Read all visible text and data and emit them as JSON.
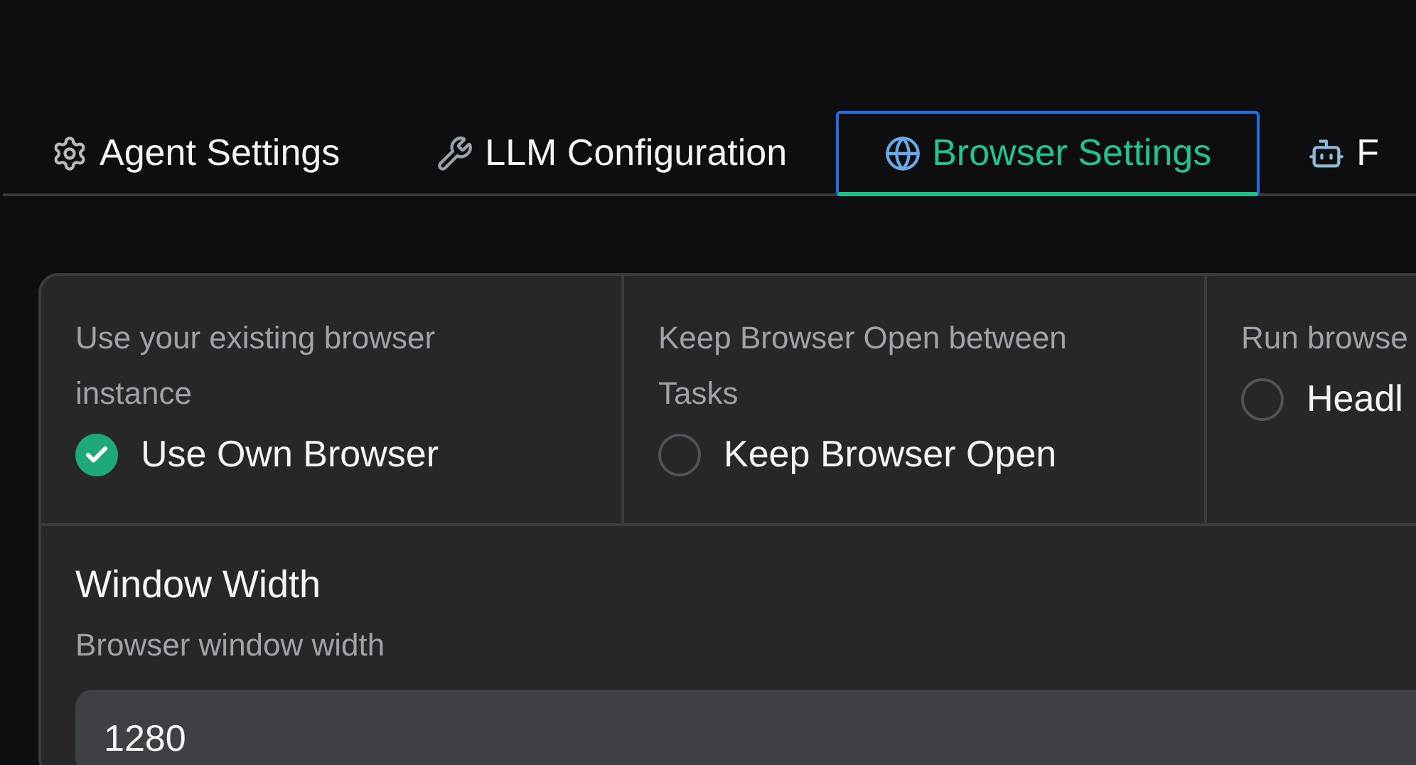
{
  "tabs": [
    {
      "label": "Agent Settings",
      "selected": false
    },
    {
      "label": "LLM Configuration",
      "selected": false
    },
    {
      "label": "Browser Settings",
      "selected": true
    },
    {
      "label": "F",
      "selected": false
    }
  ],
  "options": [
    {
      "description": "Use your existing browser instance",
      "label": "Use Own Browser",
      "checked": true
    },
    {
      "description": "Keep Browser Open between Tasks",
      "label": "Keep Browser Open",
      "checked": false
    },
    {
      "description": "Run browse",
      "label": "Headl",
      "checked": false
    }
  ],
  "window_width": {
    "label": "Window Width",
    "description": "Browser window width",
    "value": "1280"
  }
}
